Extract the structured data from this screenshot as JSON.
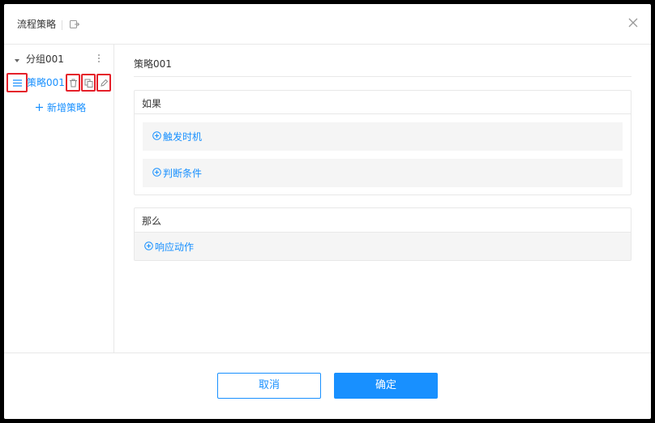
{
  "dialog": {
    "title": "流程策略",
    "close_icon": "close-icon",
    "export_icon": "export-icon"
  },
  "sidebar": {
    "group": {
      "label": "分组001"
    },
    "strategy": {
      "label": "策略001"
    },
    "add_label": "新增策略"
  },
  "main": {
    "strategy_name": "策略001",
    "if_panel": {
      "title": "如果",
      "trigger_label": "触发时机",
      "condition_label": "判断条件"
    },
    "then_panel": {
      "title": "那么",
      "action_label": "响应动作"
    }
  },
  "footer": {
    "cancel_label": "取消",
    "ok_label": "确定"
  },
  "colors": {
    "accent": "#1890ff",
    "highlight_border": "#e5202a",
    "panel_bg": "#f5f5f5"
  }
}
